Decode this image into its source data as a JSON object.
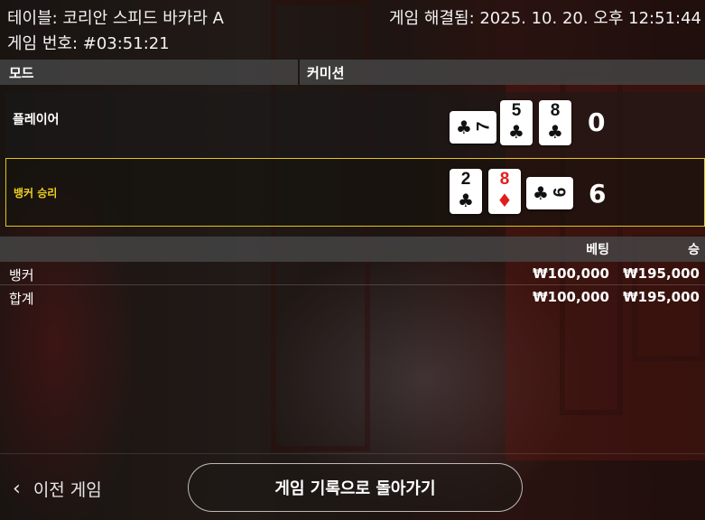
{
  "header": {
    "table_title": "테이블: 코리안 스피드 바카라 A",
    "game_number": "게임 번호: #03:51:21",
    "resolved": "게임 해결됨: 2025. 10. 20. 오후 12:51:44"
  },
  "columns": {
    "mode": "모드",
    "commission": "커미션"
  },
  "player": {
    "label": "플레이어",
    "score": "0",
    "cards": [
      {
        "rank": "7",
        "suit": "♣",
        "color": "#111111"
      },
      {
        "rank": "5",
        "suit": "♣",
        "color": "#111111"
      },
      {
        "rank": "8",
        "suit": "♣",
        "color": "#111111"
      }
    ]
  },
  "banker": {
    "label": "뱅커 승리",
    "score": "6",
    "cards": [
      {
        "rank": "2",
        "suit": "♣",
        "color": "#111111"
      },
      {
        "rank": "8",
        "suit": "♦",
        "color": "#e01e1e"
      },
      {
        "rank": "6",
        "suit": "♣",
        "color": "#111111"
      }
    ]
  },
  "summary": {
    "headers": {
      "bet": "베팅",
      "win": "승"
    },
    "rows": [
      {
        "label": "뱅커",
        "bet": "₩100,000",
        "win": "₩195,000"
      },
      {
        "label": "합계",
        "bet": "₩100,000",
        "win": "₩195,000"
      }
    ]
  },
  "footer": {
    "prev_icon": "‹",
    "prev_label": "이전 게임",
    "back_label": "게임 기록으로 돌아가기"
  },
  "colors": {
    "winner_highlight": "#e0c51c",
    "header_band": "#464646"
  }
}
